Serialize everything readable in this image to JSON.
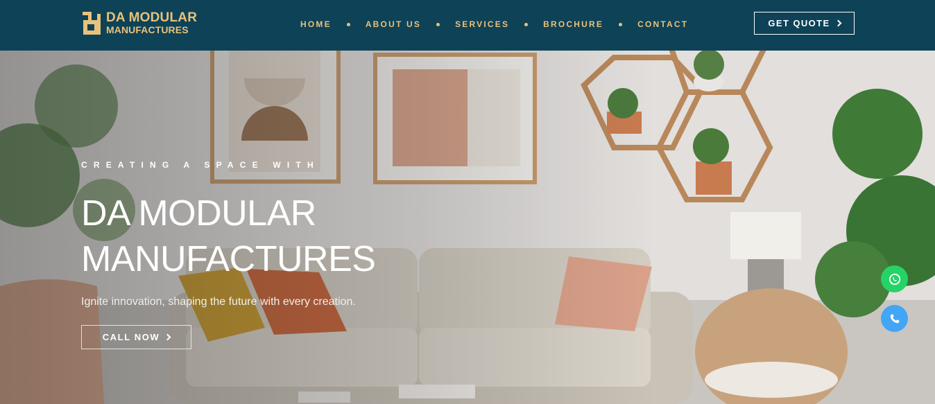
{
  "brand": {
    "name_line1": "DA MODULAR",
    "name_line2": "MANUFACTURES",
    "color": "#e8c27a",
    "header_bg": "#0e4257"
  },
  "nav": {
    "items": [
      {
        "label": "HOME"
      },
      {
        "label": "ABOUT US"
      },
      {
        "label": "SERVICES"
      },
      {
        "label": "BROCHURE"
      },
      {
        "label": "CONTACT"
      }
    ]
  },
  "header": {
    "quote_label": "GET QUOTE",
    "quote_icon": "chevron-right-icon"
  },
  "hero": {
    "eyebrow": "CREATING A SPACE WITH",
    "title_line1": "DA MODULAR",
    "title_line2": "MANUFACTURES",
    "subtitle": "Ignite innovation, shaping the future with every creation.",
    "cta_label": "CALL NOW",
    "cta_icon": "chevron-right-icon"
  },
  "floating": {
    "whatsapp_icon": "whatsapp-icon",
    "whatsapp_color": "#25d366",
    "phone_icon": "phone-icon",
    "phone_color": "#42a5f5"
  }
}
